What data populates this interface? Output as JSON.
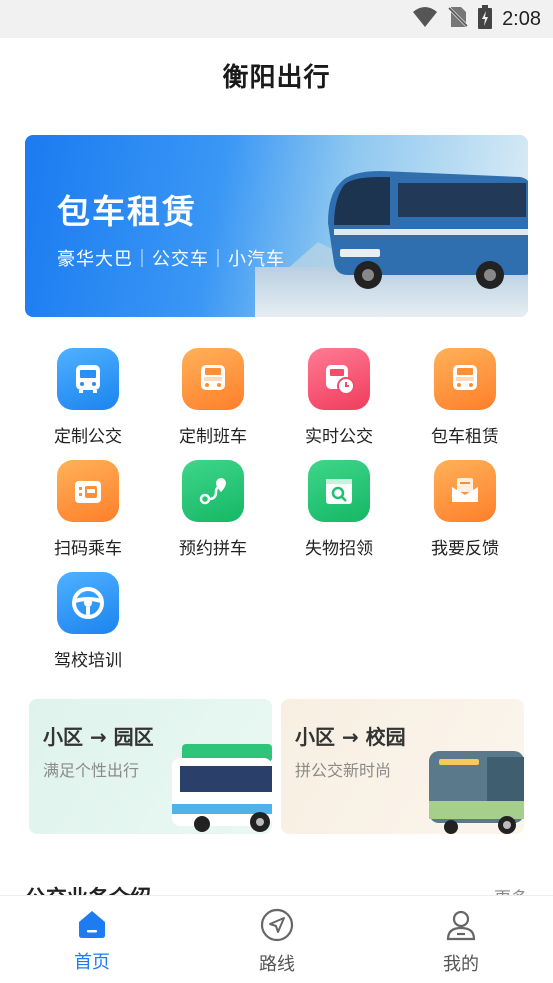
{
  "status_bar": {
    "time": "2:08",
    "icons": [
      "wifi-icon",
      "no-sim-icon",
      "battery-charging-icon"
    ]
  },
  "app": {
    "title": "衡阳出行"
  },
  "banner": {
    "title": "包车租赁",
    "subtitle": "豪华大巴｜公交车｜小汽车"
  },
  "services": [
    {
      "label": "定制公交",
      "icon": "bus-icon",
      "color": "#2a8ff4"
    },
    {
      "label": "定制班车",
      "icon": "school-bus-icon",
      "color": "#ff8f35"
    },
    {
      "label": "实时公交",
      "icon": "bus-clock-icon",
      "color": "#f44d6c"
    },
    {
      "label": "包车租赁",
      "icon": "rental-bus-icon",
      "color": "#ff8f35"
    },
    {
      "label": "扫码乘车",
      "icon": "scan-ticket-icon",
      "color": "#ff8f35"
    },
    {
      "label": "预约拼车",
      "icon": "route-pin-icon",
      "color": "#1fc06f"
    },
    {
      "label": "失物招领",
      "icon": "lost-found-icon",
      "color": "#1fc06f"
    },
    {
      "label": "我要反馈",
      "icon": "feedback-mail-icon",
      "color": "#ff8f35"
    },
    {
      "label": "驾校培训",
      "icon": "steering-wheel-icon",
      "color": "#2a8ff4"
    }
  ],
  "promo_cards": [
    {
      "title": "小区 → 园区",
      "subtitle": "满足个性出行"
    },
    {
      "title": "小区 → 校园",
      "subtitle": "拼公交新时尚"
    }
  ],
  "section": {
    "title": "公交业务介绍",
    "more": "更多"
  },
  "tabs": [
    {
      "label": "首页",
      "icon": "home-icon",
      "active": true
    },
    {
      "label": "路线",
      "icon": "compass-icon",
      "active": false
    },
    {
      "label": "我的",
      "icon": "user-icon",
      "active": false
    }
  ],
  "colors": {
    "accent": "#1d7cf2",
    "status_bar_bg": "#f1f1f1"
  }
}
